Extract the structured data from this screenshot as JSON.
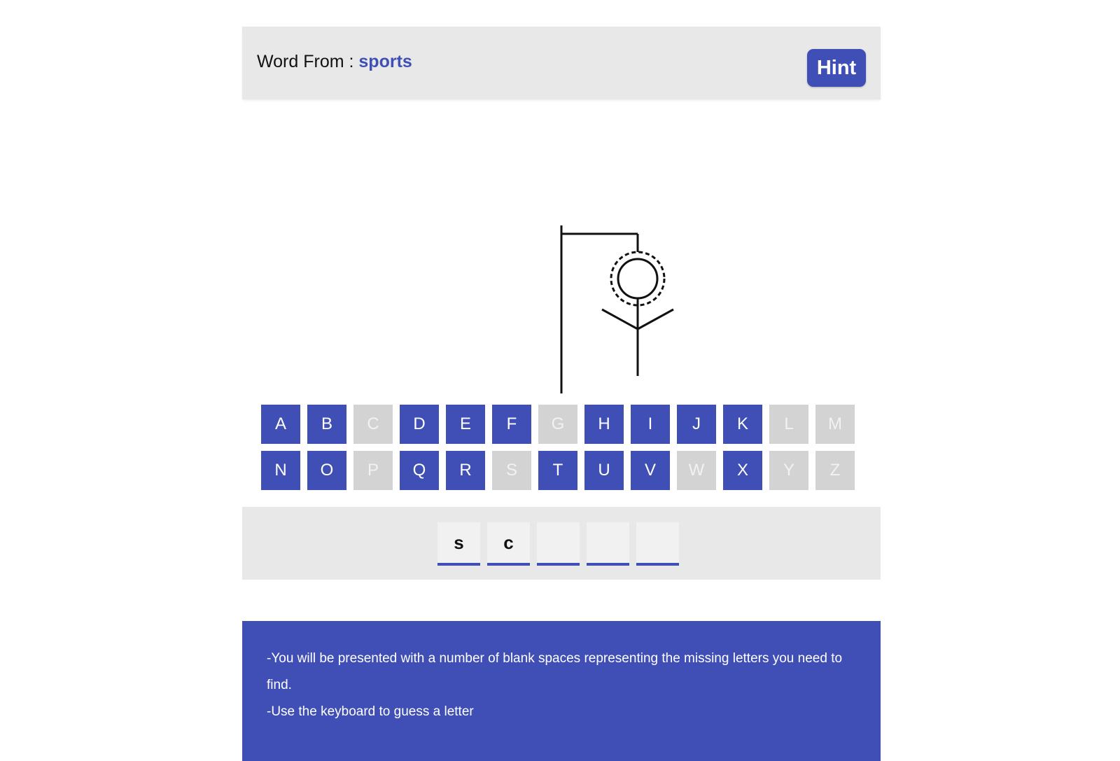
{
  "header": {
    "word_from_label": "Word From : ",
    "category": "sports",
    "hint_label": "Hint"
  },
  "keyboard": {
    "rows": [
      [
        {
          "letter": "A",
          "used": false
        },
        {
          "letter": "B",
          "used": false
        },
        {
          "letter": "C",
          "used": true
        },
        {
          "letter": "D",
          "used": false
        },
        {
          "letter": "E",
          "used": false
        },
        {
          "letter": "F",
          "used": false
        },
        {
          "letter": "G",
          "used": true
        },
        {
          "letter": "H",
          "used": false
        },
        {
          "letter": "I",
          "used": false
        },
        {
          "letter": "J",
          "used": false
        },
        {
          "letter": "K",
          "used": false
        },
        {
          "letter": "L",
          "used": true
        },
        {
          "letter": "M",
          "used": true
        }
      ],
      [
        {
          "letter": "N",
          "used": false
        },
        {
          "letter": "O",
          "used": false
        },
        {
          "letter": "P",
          "used": true
        },
        {
          "letter": "Q",
          "used": false
        },
        {
          "letter": "R",
          "used": false
        },
        {
          "letter": "S",
          "used": true
        },
        {
          "letter": "T",
          "used": false
        },
        {
          "letter": "U",
          "used": false
        },
        {
          "letter": "V",
          "used": false
        },
        {
          "letter": "W",
          "used": true
        },
        {
          "letter": "X",
          "used": false
        },
        {
          "letter": "Y",
          "used": true
        },
        {
          "letter": "Z",
          "used": true
        }
      ]
    ]
  },
  "word": {
    "slots": [
      "s",
      "c",
      "",
      "",
      ""
    ]
  },
  "rules": {
    "lines": [
      "-You will be presented with a number of blank spaces representing the missing letters you need to find.",
      "-Use the keyboard to guess a letter"
    ]
  },
  "colors": {
    "accent": "#3f4fb5",
    "used_key": "#d3d3d3",
    "panel": "#e8e8e8"
  }
}
